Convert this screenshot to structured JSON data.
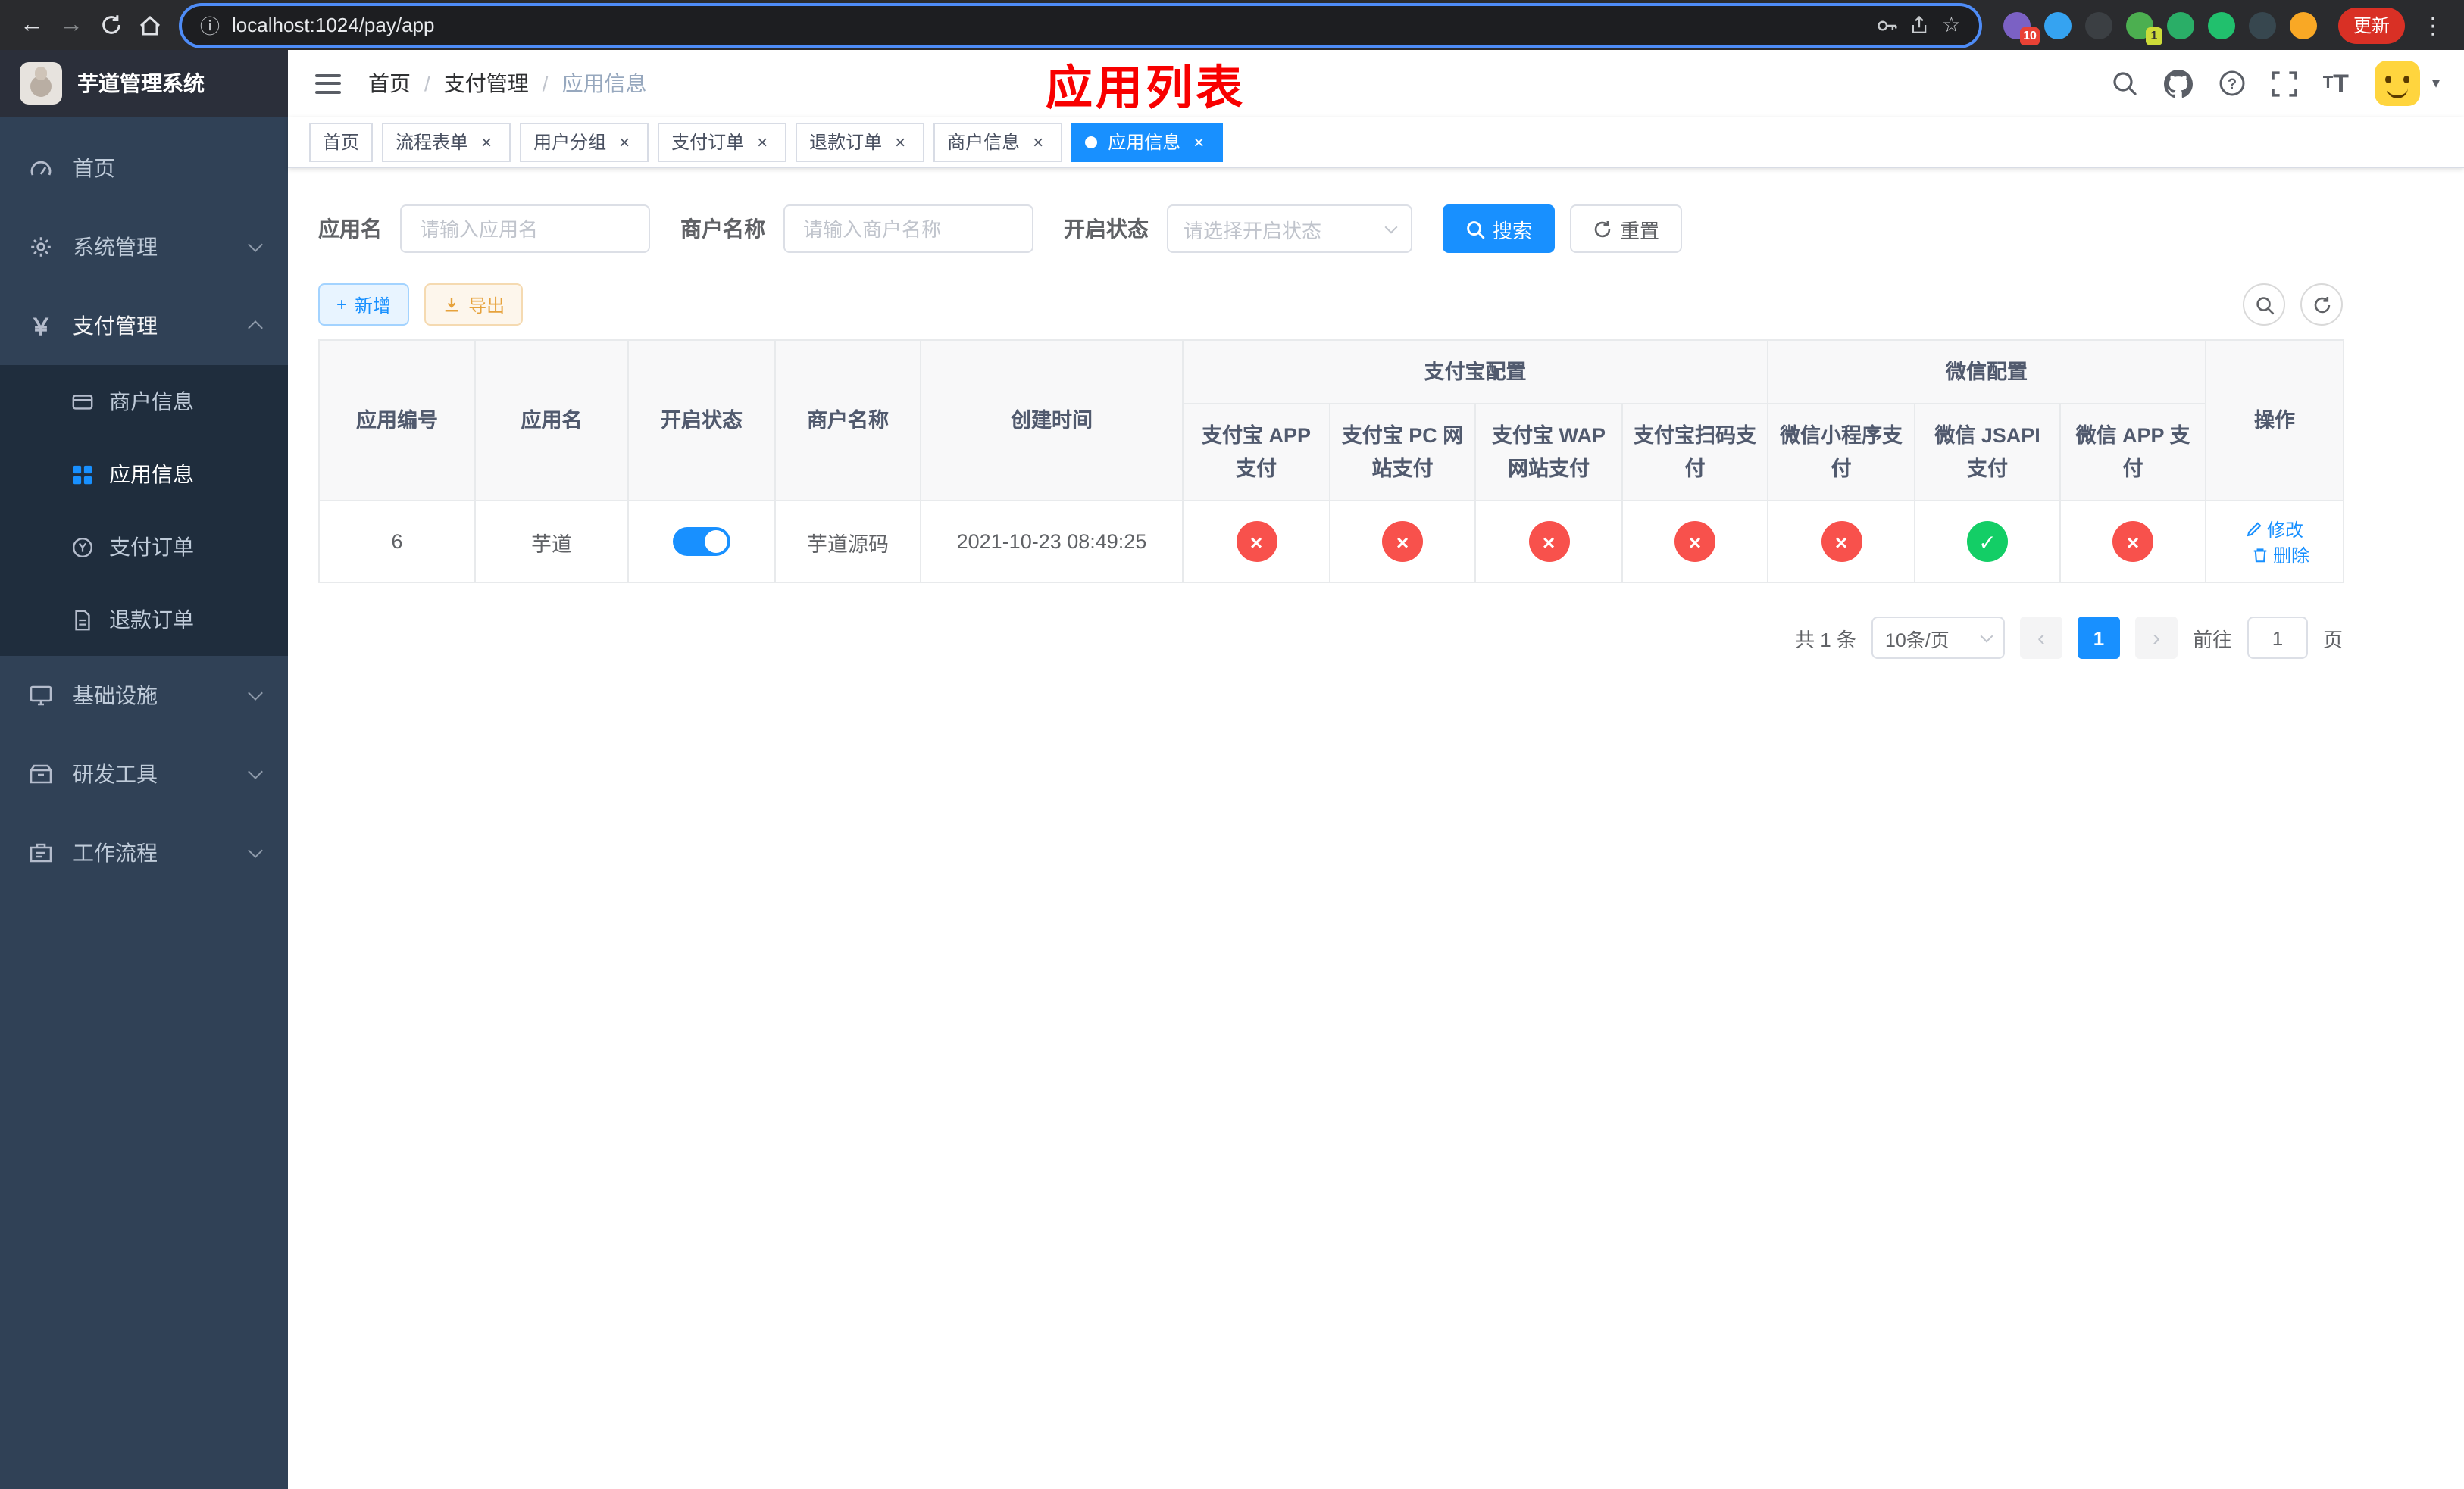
{
  "browser": {
    "url": "localhost:1024/pay/app",
    "update_button": "更新",
    "ext_badge_first": "10",
    "ext_badge_fourth": "1"
  },
  "sidebar": {
    "app_title": "芋道管理系统",
    "home": "首页",
    "system": "系统管理",
    "payment": "支付管理",
    "merchant_info": "商户信息",
    "app_info": "应用信息",
    "pay_order": "支付订单",
    "refund_order": "退款订单",
    "infrastructure": "基础设施",
    "dev_tools": "研发工具",
    "workflow": "工作流程"
  },
  "header": {
    "breadcrumb": [
      "首页",
      "支付管理",
      "应用信息"
    ],
    "annotation": "应用列表"
  },
  "tags": [
    {
      "label": "首页"
    },
    {
      "label": "流程表单"
    },
    {
      "label": "用户分组"
    },
    {
      "label": "支付订单"
    },
    {
      "label": "退款订单"
    },
    {
      "label": "商户信息"
    },
    {
      "label": "应用信息"
    }
  ],
  "filters": {
    "app_name_label": "应用名",
    "app_name_placeholder": "请输入应用名",
    "merchant_label": "商户名称",
    "merchant_placeholder": "请输入商户名称",
    "status_label": "开启状态",
    "status_placeholder": "请选择开启状态",
    "search_button": "搜索",
    "reset_button": "重置"
  },
  "toolbar": {
    "add_button": "新增",
    "export_button": "导出"
  },
  "table": {
    "col_app_id": "应用编号",
    "col_app_name": "应用名",
    "col_status": "开启状态",
    "col_merchant": "商户名称",
    "col_created": "创建时间",
    "col_actions": "操作",
    "group_alipay": "支付宝配置",
    "group_wechat": "微信配置",
    "col_alipay_app": "支付宝 APP 支付",
    "col_alipay_pc": "支付宝 PC 网站支付",
    "col_alipay_wap": "支付宝 WAP 网站支付",
    "col_alipay_qr": "支付宝扫码支付",
    "col_wx_mini": "微信小程序支付",
    "col_wx_jsapi": "微信 JSAPI 支付",
    "col_wx_app": "微信 APP 支付",
    "rows": [
      {
        "app_id": "6",
        "app_name": "芋道",
        "enabled": true,
        "merchant": "芋道源码",
        "created_at": "2021-10-23 08:49:25",
        "channels": [
          "error",
          "error",
          "error",
          "error",
          "error",
          "success",
          "error"
        ],
        "edit_label": "修改",
        "delete_label": "删除"
      }
    ]
  },
  "pagination": {
    "total_text": "共 1 条",
    "page_size": "10条/页",
    "current_page": "1",
    "goto_prefix": "前往",
    "goto_value": "1",
    "goto_suffix": "页"
  },
  "colors": {
    "primary": "#1890ff",
    "success": "#13ce66",
    "danger": "#f8514c",
    "warning": "#e6a23c",
    "annotation_red": "#f80000",
    "sidebar_bg": "#304156",
    "sidebar_sub_bg": "#1f2d3d"
  }
}
